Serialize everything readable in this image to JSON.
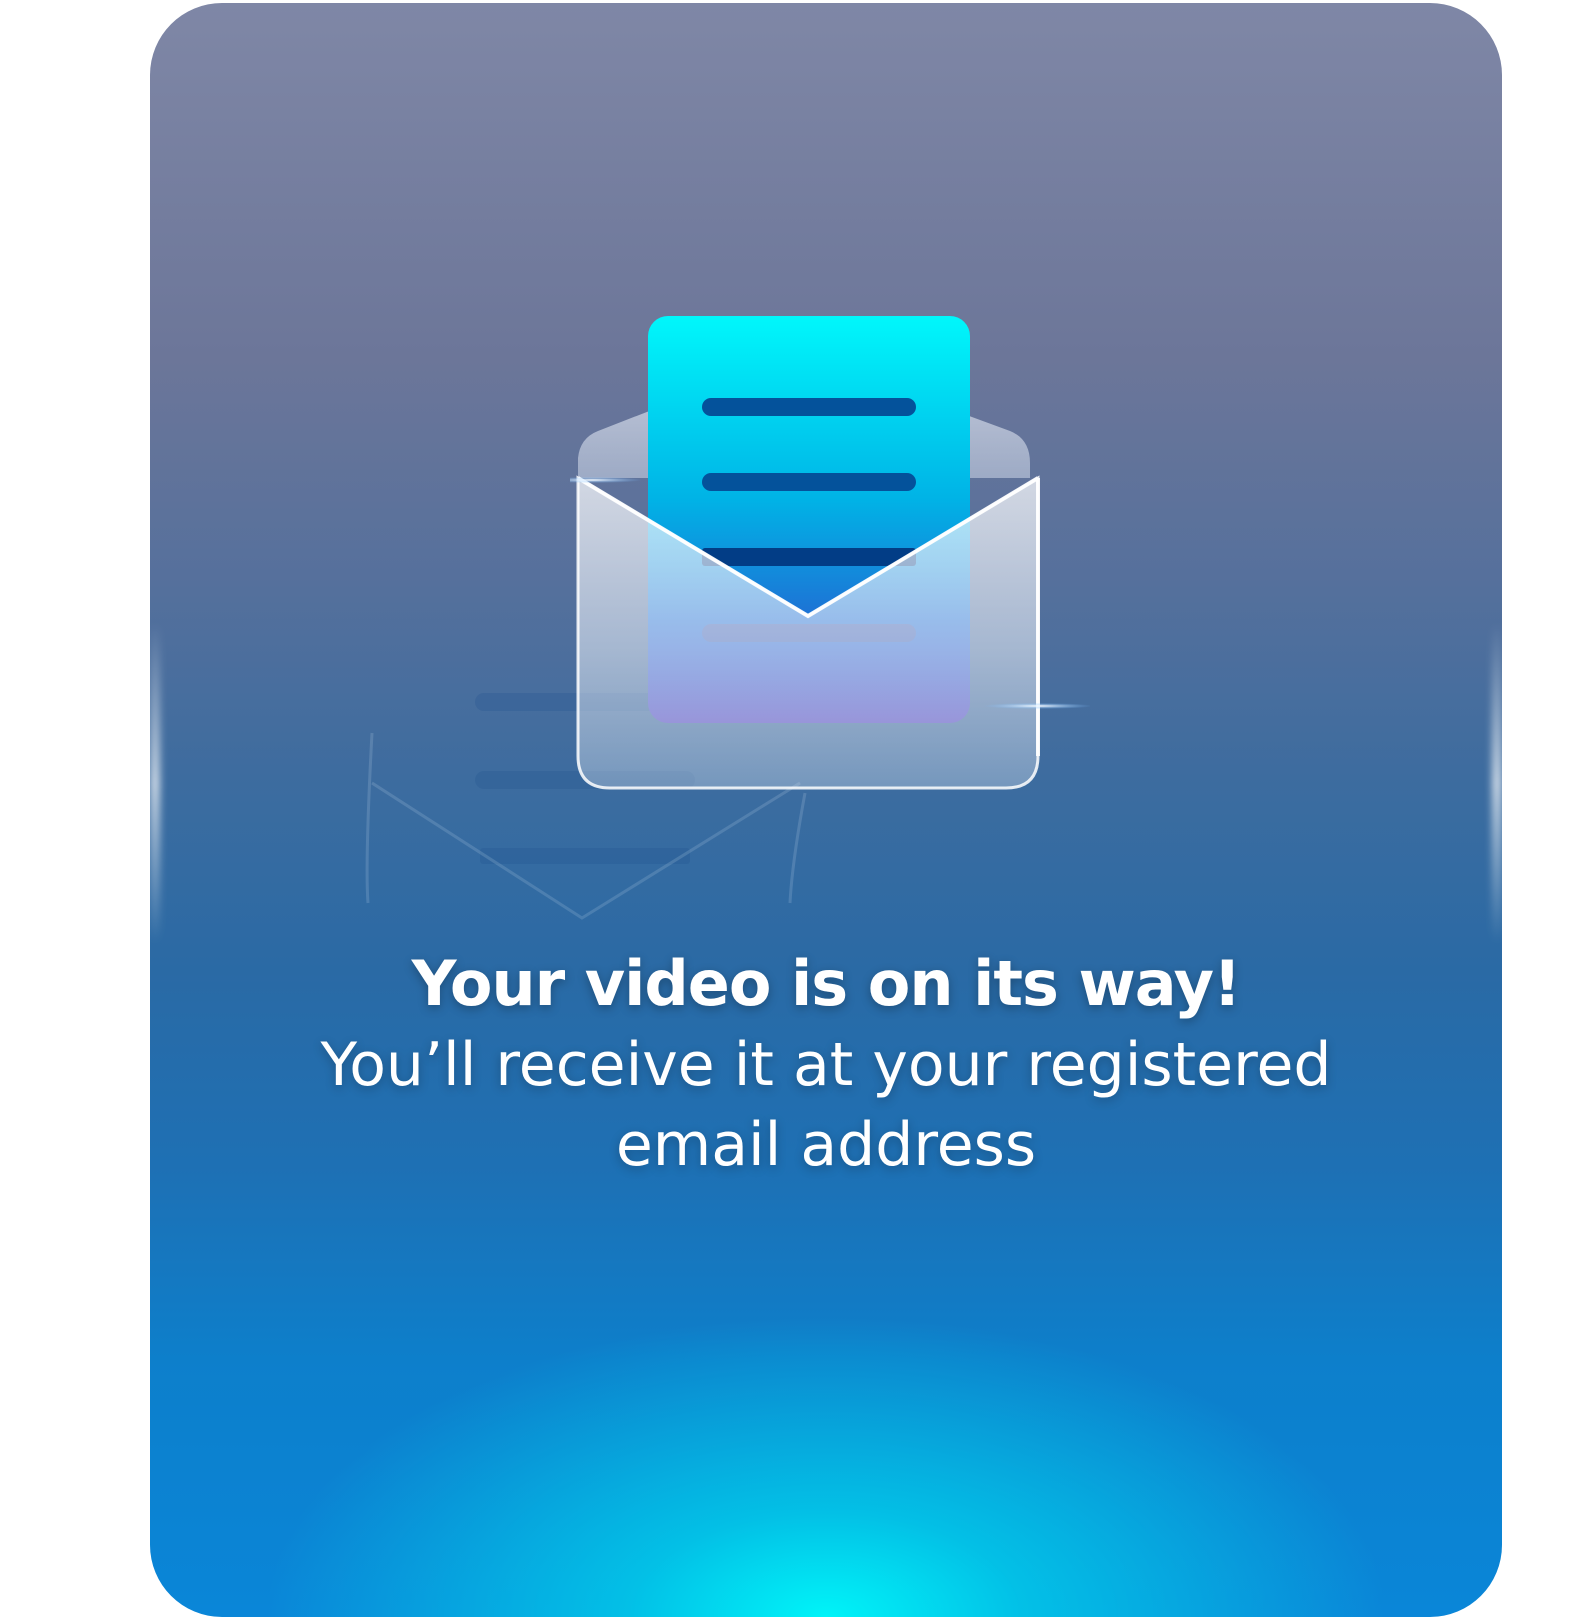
{
  "message": {
    "title": "Your video is on its way!",
    "body": "You’ll receive it at your registered email address"
  },
  "illustration": {
    "icon": "open-envelope-with-letter-icon"
  },
  "colors": {
    "card_top": "#7f87a6",
    "card_bottom": "#0a86d8",
    "glow": "#00f4f8",
    "letter_top": "#00f7fb",
    "letter_bottom": "#5a4fc2",
    "text": "#ffffff"
  }
}
